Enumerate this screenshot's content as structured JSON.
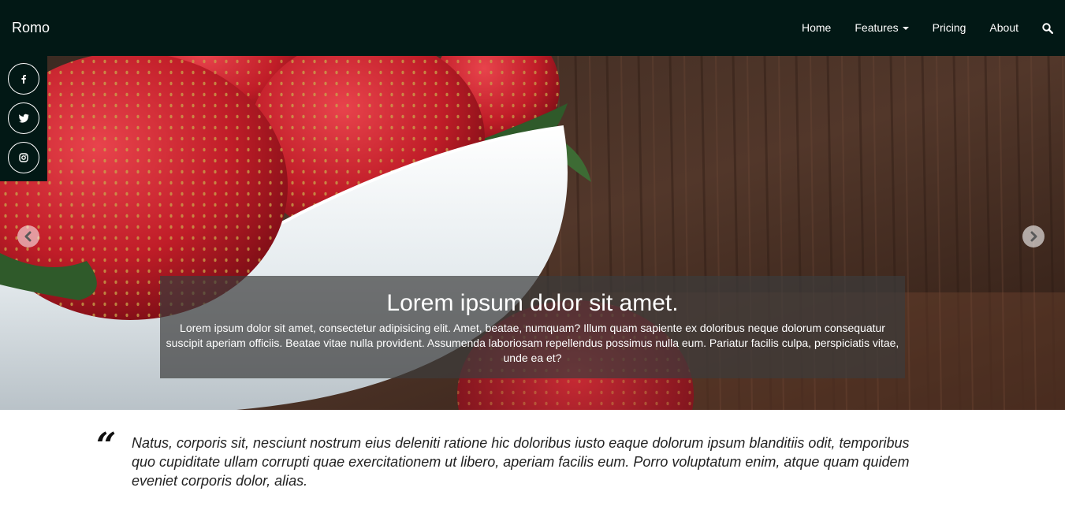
{
  "nav": {
    "brand": "Romo",
    "links": {
      "home": "Home",
      "features": "Features",
      "pricing": "Pricing",
      "about": "About"
    }
  },
  "social": {
    "icons": [
      "facebook-icon",
      "twitter-icon",
      "instagram-icon"
    ]
  },
  "hero": {
    "title": "Lorem ipsum dolor sit amet.",
    "text": "Lorem ipsum dolor sit amet, consectetur adipisicing elit. Amet, beatae, numquam? Illum quam sapiente ex doloribus neque dolorum consequatur suscipit aperiam officiis. Beatae vitae nulla provident. Assumenda laboriosam repellendus possimus nulla eum. Pariatur facilis culpa, perspiciatis vitae, unde ea et?"
  },
  "quote": {
    "mark": "“",
    "text": "Natus, corporis sit, nesciunt nostrum eius deleniti ratione hic doloribus iusto eaque dolorum ipsum blanditiis odit, temporibus quo cupiditate ullam corrupti quae exercitationem ut libero, aperiam facilis eum. Porro voluptatum enim, atque quam quidem eveniet corporis dolor, alias."
  },
  "colors": {
    "navbar": "#021815",
    "caption_bg": "rgba(60,60,60,0.7)"
  }
}
